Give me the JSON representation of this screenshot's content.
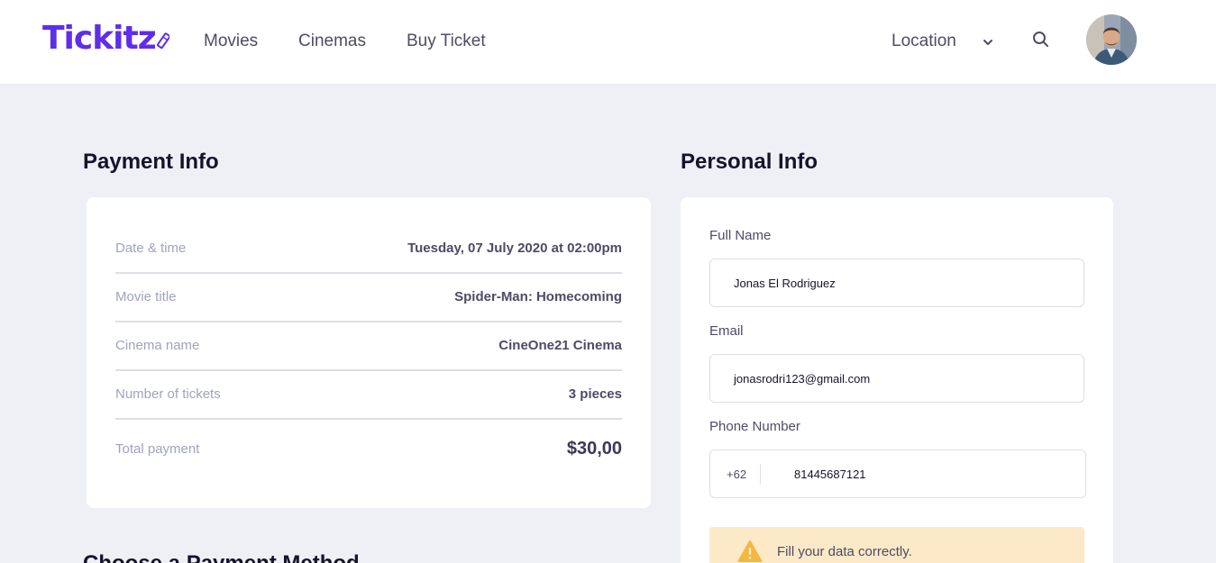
{
  "nav": {
    "logo": "Tickitz",
    "links": [
      "Movies",
      "Cinemas",
      "Buy Ticket"
    ],
    "location": "Location",
    "accent": "#5f2eea"
  },
  "payment": {
    "title": "Payment Info",
    "rows": [
      {
        "label": "Date & time",
        "value": "Tuesday, 07 July 2020 at 02:00pm"
      },
      {
        "label": "Movie title",
        "value": "Spider-Man: Homecoming"
      },
      {
        "label": "Cinema name",
        "value": "CineOne21 Cinema"
      },
      {
        "label": "Number of tickets",
        "value": "3 pieces"
      },
      {
        "label": "Total payment",
        "value": "$30,00"
      }
    ],
    "method_title": "Choose a Payment Method"
  },
  "personal": {
    "title": "Personal Info",
    "full_name_label": "Full Name",
    "full_name_value": "Jonas El Rodriguez",
    "email_label": "Email",
    "email_value": "jonasrodri123@gmail.com",
    "phone_label": "Phone Number",
    "phone_code": "+62",
    "phone_value": "81445687121",
    "alert": "Fill your data correctly.",
    "alert_color": "#fbe9c7"
  },
  "icons": {
    "location_chevron": "chevron-down-icon",
    "search": "search-icon",
    "warning": "warning-icon"
  }
}
